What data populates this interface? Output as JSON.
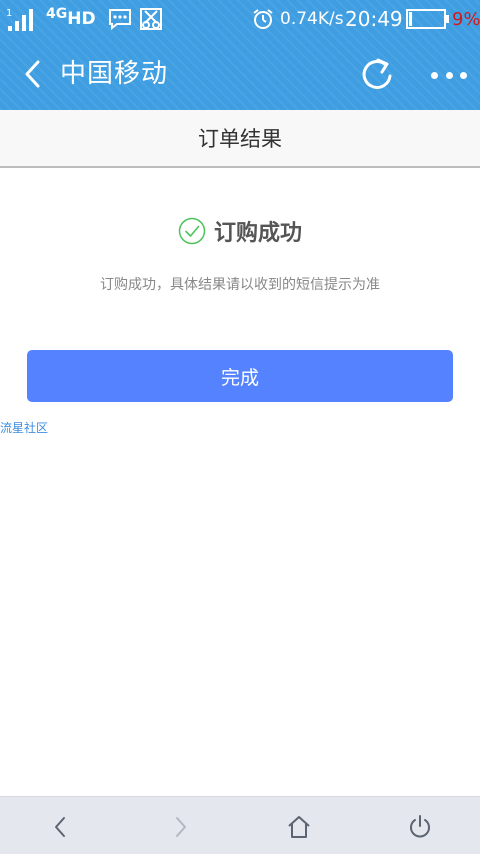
{
  "status_bar": {
    "sim_slot": "1",
    "network_type": "4G",
    "hd_label": "HD",
    "speed": "0.74K/s",
    "time": "20:49",
    "battery_percent": 9,
    "battery_text": "9%"
  },
  "title_bar": {
    "title": "中国移动"
  },
  "page": {
    "header": "订单结果",
    "result_title": "订购成功",
    "description": "订购成功，具体结果请以收到的短信提示为准",
    "done_button": "完成",
    "community_link": "流星社区"
  },
  "colors": {
    "top_bar": "#3f9ee2",
    "button": "#5583ff",
    "success": "#4cc35c",
    "battery_low": "#d11a1a",
    "link": "#3c8de0"
  },
  "icons": {
    "status": [
      "signal-icon",
      "message-icon",
      "scissor-icon",
      "alarm-icon",
      "battery-icon"
    ],
    "title": [
      "back-icon",
      "refresh-icon",
      "more-icon"
    ],
    "nav": [
      "nav-back-icon",
      "nav-forward-icon",
      "nav-home-icon",
      "nav-power-icon"
    ]
  }
}
